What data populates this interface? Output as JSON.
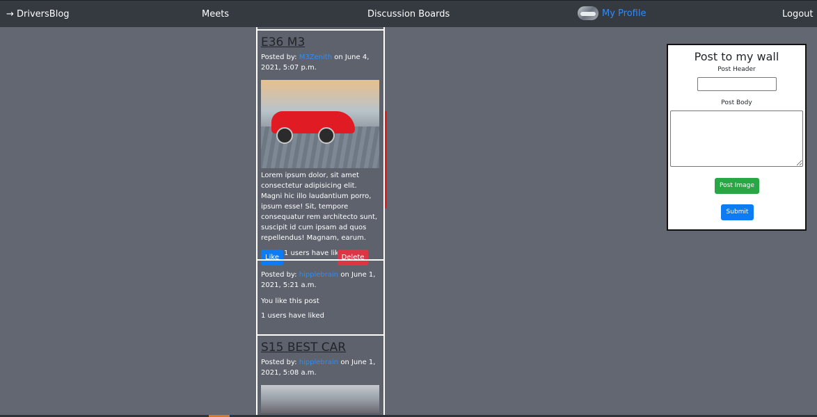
{
  "navbar": {
    "brand": "→ DriversBlog",
    "meets": "Meets",
    "discussion_boards": "Discussion Boards",
    "my_profile": "My Profile",
    "logout": "Logout"
  },
  "feed": {
    "posts": [
      {
        "title": "E36 M3",
        "posted_by_label": "Posted by: ",
        "author": "M3Zenith",
        "date": " on June 4, 2021, 5:07 p.m.",
        "body": "Lorem ipsum dolor, sit amet consectetur adipisicing elit. Magni hic illo laudantium porro, ipsum esse! Sit, tempore consequatur rem architecto sunt, suscipit id cum ipsam ad quos repellendus! Magnam, earum.",
        "like_label": "Like",
        "likes_text": "1 users have liked",
        "delete_label": "Delete"
      },
      {
        "title": "",
        "posted_by_label": "Posted by: ",
        "author": "hipplebrain",
        "date": " on June 1, 2021, 5:21 a.m.",
        "liked_text": "You like this post",
        "likes_text": "1 users have liked"
      },
      {
        "title": "S15 BEST CAR",
        "posted_by_label": "Posted by: ",
        "author": "hipplebrain",
        "date": " on June 1, 2021, 5:08 a.m."
      }
    ]
  },
  "form": {
    "title": "Post to my wall",
    "header_label": "Post Header",
    "header_value": "",
    "body_label": "Post Body",
    "body_value": "",
    "post_image_label": "Post Image",
    "submit_label": "Submit"
  },
  "colors": {
    "background": "#626771",
    "navbar": "#343a40",
    "link": "#2f8dfb",
    "like": "#0d7cf2",
    "delete": "#dc3545",
    "post_image": "#28a745"
  }
}
